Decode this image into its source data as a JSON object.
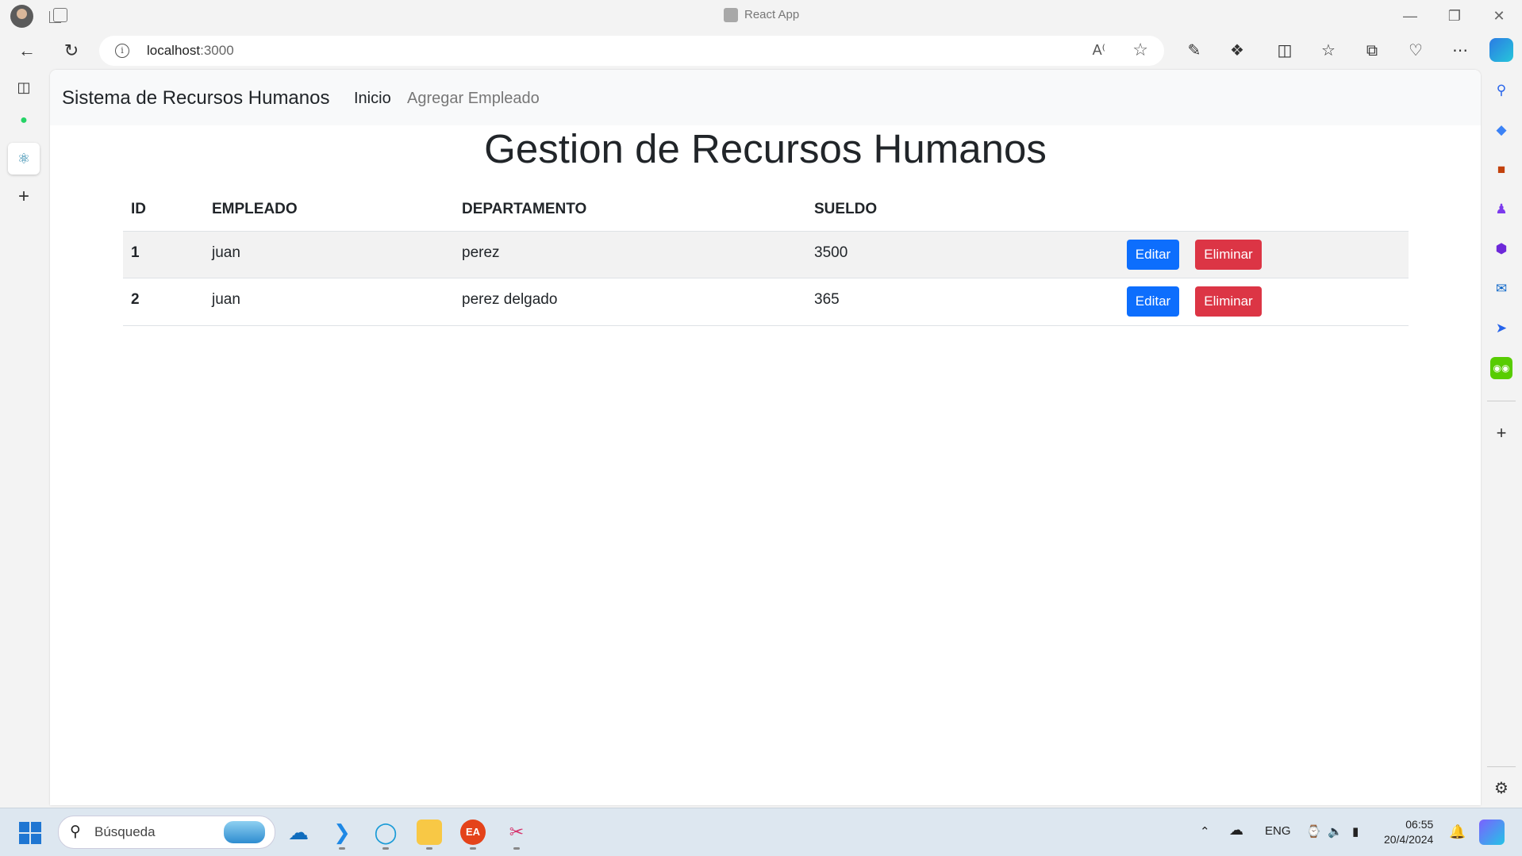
{
  "browser": {
    "window_title": "React App",
    "url_host": "localhost",
    "url_port": ":3000"
  },
  "app": {
    "brand": "Sistema de Recursos Humanos",
    "nav": [
      {
        "label": "Inicio"
      },
      {
        "label": "Agregar Empleado"
      }
    ],
    "heading": "Gestion de Recursos Humanos",
    "table": {
      "headers": [
        "ID",
        "EMPLEADO",
        "DEPARTAMENTO",
        "SUELDO"
      ],
      "rows": [
        {
          "id": "1",
          "empleado": "juan",
          "departamento": "perez",
          "sueldo": "3500",
          "edit_label": "Editar",
          "delete_label": "Eliminar"
        },
        {
          "id": "2",
          "empleado": "juan",
          "departamento": "perez delgado",
          "sueldo": "365",
          "edit_label": "Editar",
          "delete_label": "Eliminar"
        }
      ]
    }
  },
  "taskbar": {
    "search_label": "Búsqueda",
    "language": "ENG",
    "time": "06:55",
    "date": "20/4/2024"
  },
  "colors": {
    "primary": "#0d6efd",
    "danger": "#dc3545",
    "navbar_bg": "#f8f9fa"
  }
}
